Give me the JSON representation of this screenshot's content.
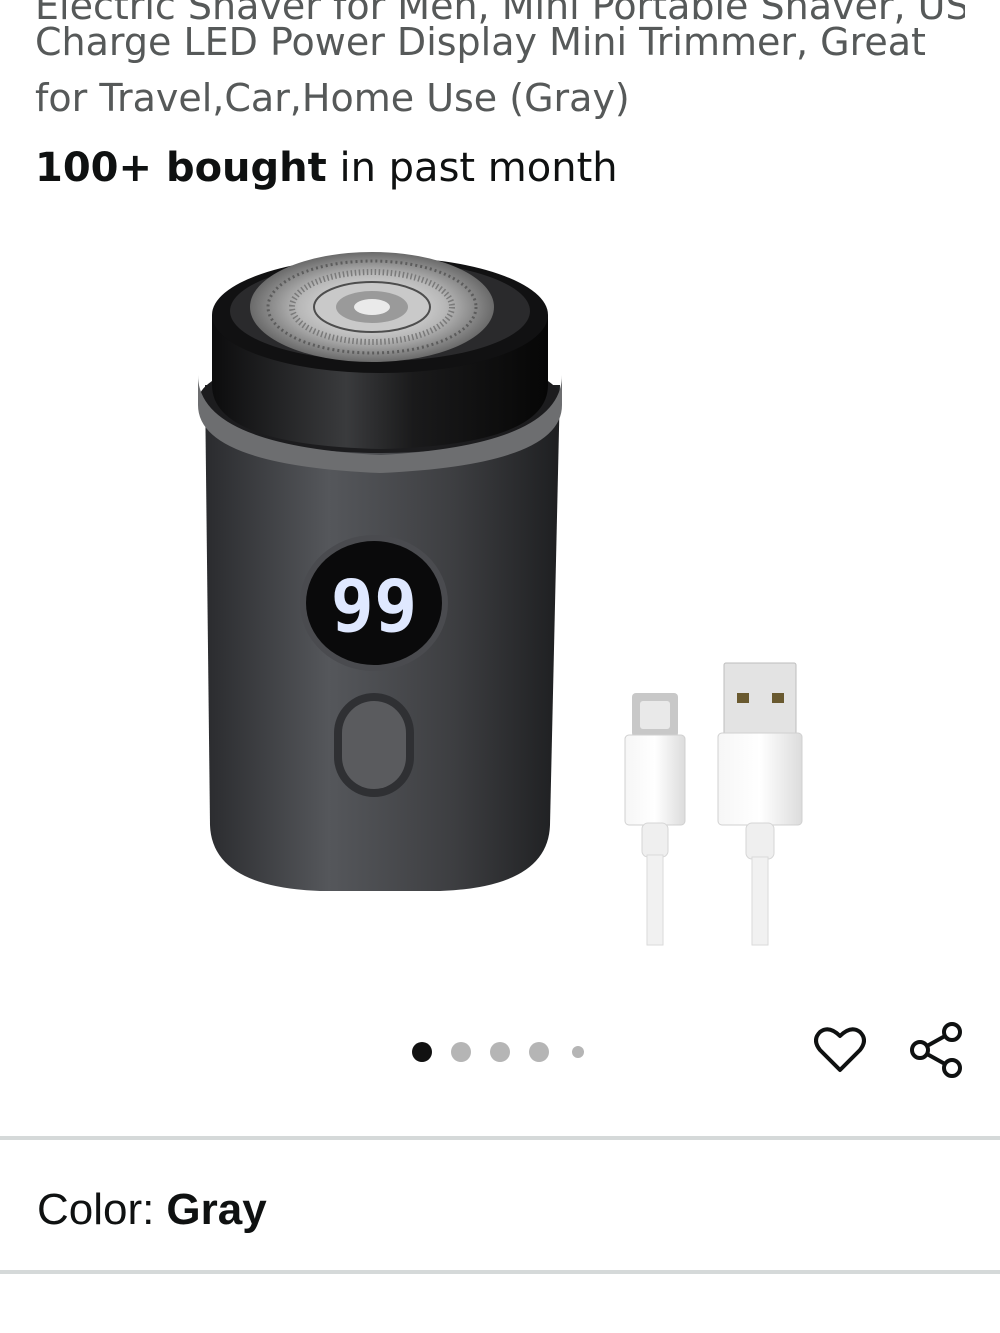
{
  "product": {
    "title_cut_line": "Electric Shaver for Men, Mini Portable Shaver, USB Fast",
    "title_lines": [
      "Charge LED Power Display Mini Trimmer, Great",
      "for Travel,Car,Home Use (Gray)"
    ],
    "bought_count": "100+ bought",
    "bought_suffix": " in past month",
    "display_digits": "99"
  },
  "gallery": {
    "image_count": 5,
    "active_index": 0,
    "icons": [
      "heart-icon",
      "share-icon"
    ]
  },
  "variation": {
    "label": "Color:",
    "value": "Gray"
  },
  "colors": {
    "text_primary": "#0f1111",
    "text_secondary": "#565959",
    "divider": "#d5d9d9",
    "dot_active": "#111111",
    "dot_inactive": "#b5b5b5"
  }
}
